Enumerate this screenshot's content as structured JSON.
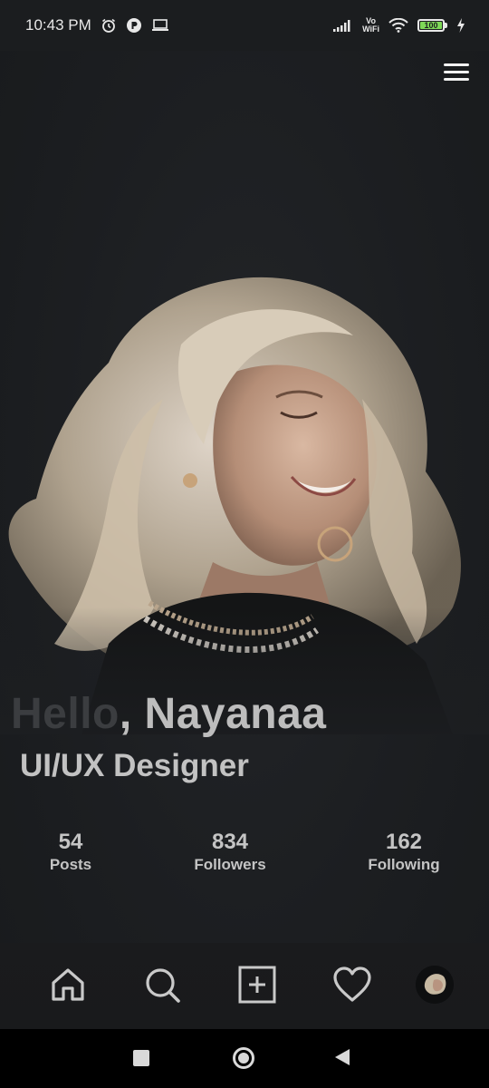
{
  "status_bar": {
    "time": "10:43 PM",
    "icons": [
      "alarm-icon",
      "app-notification-icon",
      "laptop-icon",
      "signal-icon",
      "vowifi-icon",
      "wifi-icon",
      "battery-icon",
      "charging-icon"
    ],
    "vowifi_top": "Vo",
    "vowifi_bottom": "WiFi",
    "battery_level": "100"
  },
  "header": {
    "menu_icon": "hamburger-menu-icon"
  },
  "profile": {
    "greeting_prefix": "Hello",
    "greeting_rest": ", Nayanaa",
    "role": "UI/UX Designer"
  },
  "stats": [
    {
      "value": "54",
      "label": "Posts"
    },
    {
      "value": "834",
      "label": "Followers"
    },
    {
      "value": "162",
      "label": "Following"
    }
  ],
  "bottom_nav": {
    "items": [
      "home-icon",
      "search-icon",
      "add-post-icon",
      "heart-icon",
      "profile-avatar"
    ]
  },
  "system_nav": {
    "items": [
      "recents-button",
      "home-button",
      "back-button"
    ]
  },
  "colors": {
    "background": "#1c1e21",
    "text": "#c4c4c4",
    "hello_text": "#3b3d40",
    "battery": "#7ed957"
  }
}
